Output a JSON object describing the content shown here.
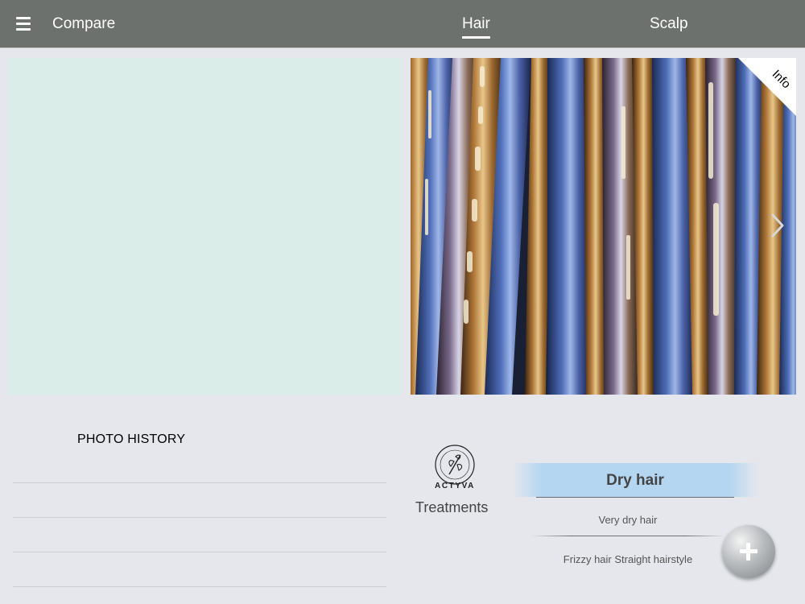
{
  "header": {
    "compare_label": "Compare",
    "tabs": [
      {
        "label": "Hair",
        "active": true
      },
      {
        "label": "Scalp",
        "active": false
      }
    ]
  },
  "photo": {
    "info_label": "Info"
  },
  "history": {
    "title": "PHOTO HISTORY"
  },
  "brand": {
    "name": "ACTYVA",
    "section_label": "Treatments"
  },
  "diagnosis": {
    "selected": "Dry hair",
    "items": [
      "Very dry hair",
      "Frizzy hair Straight hairstyle"
    ]
  },
  "colors": {
    "topbar": "#6d716e",
    "left_pane": "#daede9",
    "selected_highlight": "#b4d6f1",
    "background": "#e6e7ec"
  },
  "icons": [
    "menu-icon",
    "chevron-right-icon",
    "plus-icon",
    "actyva-logo"
  ]
}
